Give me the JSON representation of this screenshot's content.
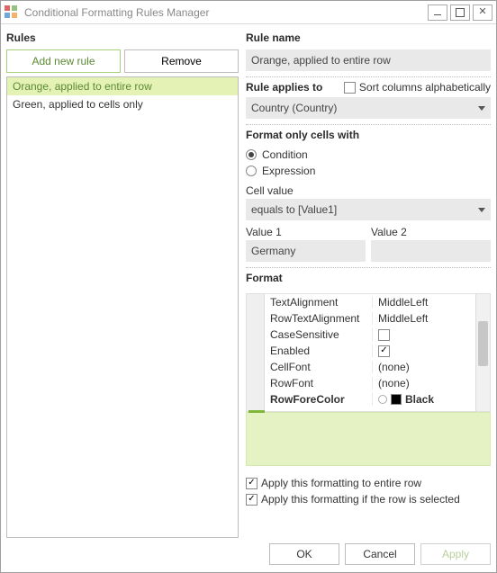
{
  "window": {
    "title": "Conditional Formatting Rules Manager"
  },
  "left": {
    "heading": "Rules",
    "add_btn": "Add new rule",
    "remove_btn": "Remove"
  },
  "rules": [
    {
      "label": "Orange, applied to entire row",
      "selected": true
    },
    {
      "label": "Green, applied to cells only",
      "selected": false
    }
  ],
  "right": {
    "rule_name_heading": "Rule name",
    "rule_name_value": "Orange, applied to entire row",
    "applies_heading": "Rule applies to",
    "sort_cols_label": "Sort columns alphabetically",
    "sort_cols_checked": false,
    "applies_value": "Country (Country)",
    "format_only_heading": "Format only cells with",
    "radio_condition": "Condition",
    "radio_expression": "Expression",
    "radio_selected": "condition",
    "cell_value_heading": "Cell value",
    "cell_value_combo": "equals to [Value1]",
    "value1_label": "Value 1",
    "value2_label": "Value 2",
    "value1": "Germany",
    "value2": "",
    "format_heading": "Format",
    "apply_entire_row_label": "Apply this formatting to entire row",
    "apply_entire_row_checked": true,
    "apply_if_selected_label": "Apply this formatting if the row is selected",
    "apply_if_selected_checked": true
  },
  "propgrid": [
    {
      "name": "TextAlignment",
      "value": "MiddleLeft",
      "kind": "text"
    },
    {
      "name": "RowTextAlignment",
      "value": "MiddleLeft",
      "kind": "text"
    },
    {
      "name": "CaseSensitive",
      "value": "",
      "kind": "check-off"
    },
    {
      "name": "Enabled",
      "value": "",
      "kind": "check-on"
    },
    {
      "name": "CellFont",
      "value": "(none)",
      "kind": "text"
    },
    {
      "name": "RowFont",
      "value": "(none)",
      "kind": "text"
    },
    {
      "name": "RowForeColor",
      "value": "Black",
      "kind": "color",
      "bold": true
    }
  ],
  "footer": {
    "ok": "OK",
    "cancel": "Cancel",
    "apply": "Apply"
  }
}
